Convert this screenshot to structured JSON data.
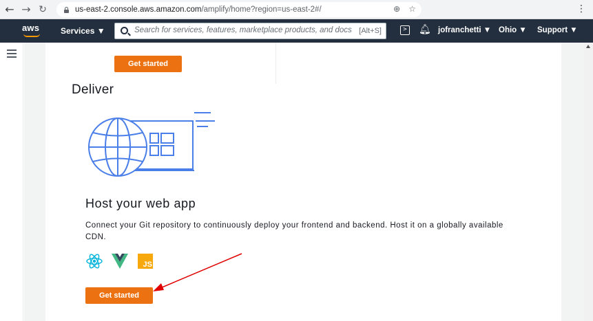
{
  "browser": {
    "url_host": "us-east-2.console.aws.amazon.com",
    "url_path": "/amplify/home?region=us-east-2#/",
    "icons": [
      "back-arrow-icon",
      "forward-arrow-icon",
      "reload-icon",
      "lock-icon",
      "zoom-icon",
      "star-icon",
      "kebab-menu-icon"
    ]
  },
  "aws_nav": {
    "logo": "aws",
    "services_label": "Services ▼",
    "search_placeholder": "Search for services, features, marketplace products, and docs",
    "search_shortcut": "[Alt+S]",
    "account_label": "jofranchetti ▼",
    "region_label": "Ohio ▼",
    "support_label": "Support ▼"
  },
  "main": {
    "top_button_label": "Get started",
    "section_heading": "Deliver",
    "card_title": "Host your web app",
    "card_description": "Connect your Git repository to continuously deploy your frontend and backend. Host it on a globally available CDN.",
    "framework_icons": [
      "react-icon",
      "vue-icon",
      "javascript-icon"
    ],
    "js_badge_text": "JS",
    "bottom_button_label": "Get started"
  },
  "colors": {
    "aws_nav_bg": "#232f3e",
    "primary_button": "#ec7211",
    "illustration_blue": "#4a7ee8",
    "annotation_arrow": "#e00000"
  }
}
